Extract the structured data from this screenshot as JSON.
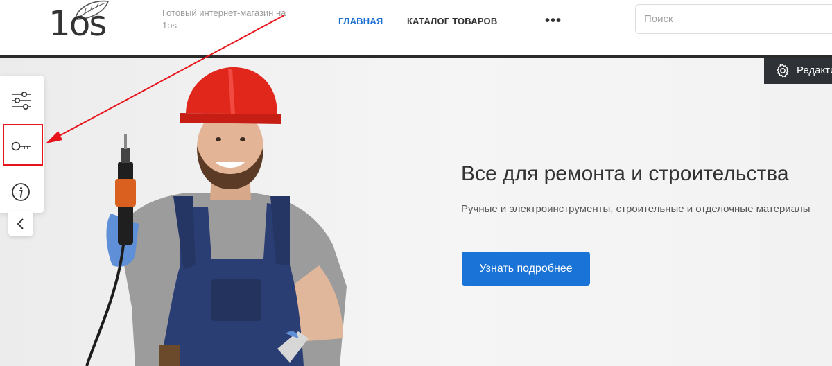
{
  "header": {
    "logo_text": "1os",
    "tagline": "Готовый интернет-магазин на 1os",
    "nav": {
      "home": "ГЛАВНАЯ",
      "catalog": "КАТАЛОГ ТОВАРОВ",
      "more": "•••"
    },
    "search": {
      "placeholder": "Поиск",
      "value": ""
    }
  },
  "edit_badge": {
    "label": "Редактировать",
    "icon": "gear-icon"
  },
  "hero": {
    "title": "Все для ремонта и строительства",
    "subtitle": "Ручные и электроинструменты, строительные и отделочные материалы",
    "button_label": "Узнать подробнее"
  },
  "side_panel": {
    "items": [
      {
        "icon": "sliders-icon"
      },
      {
        "icon": "key-icon",
        "highlighted": true
      },
      {
        "icon": "info-icon"
      }
    ],
    "collapse_icon": "chevron-left-icon"
  },
  "colors": {
    "accent_blue": "#1a73d6",
    "nav_active": "#1a6fd1",
    "annotation_red": "#e8141c",
    "dark_bar": "#2e3236"
  }
}
